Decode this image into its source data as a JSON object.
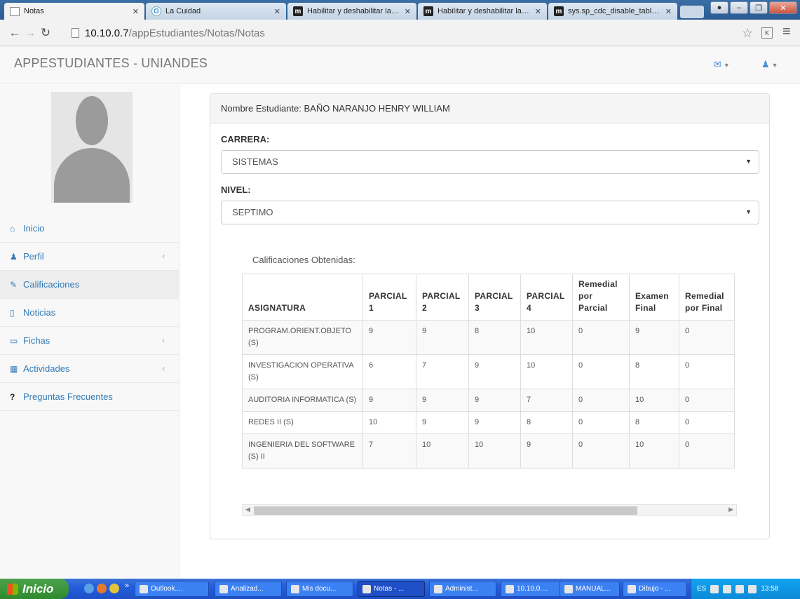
{
  "browser": {
    "tabs": [
      {
        "title": "Notas",
        "icon": "page-icon",
        "active": true
      },
      {
        "title": "La Cuidad",
        "icon": "google-icon",
        "active": false
      },
      {
        "title": "Habilitar y deshabilitar la cap",
        "icon": "m-icon",
        "active": false
      },
      {
        "title": "Habilitar y deshabilitar la cap",
        "icon": "m-icon",
        "active": false
      },
      {
        "title": "sys.sp_cdc_disable_table (Tr",
        "icon": "m-icon",
        "active": false
      }
    ],
    "url_host": "10.10.0.7",
    "url_path": "/appEstudiantes/Notas/Notas"
  },
  "app": {
    "brand": "APPESTUDIANTES - UNIANDES",
    "accent_color": "#337ab7"
  },
  "sidebar": {
    "items": [
      {
        "label": "Inicio",
        "icon": "home-icon",
        "has_arrow": false
      },
      {
        "label": "Perfil",
        "icon": "user-icon",
        "has_arrow": true
      },
      {
        "label": "Calificaciones",
        "icon": "edit-icon",
        "has_arrow": false,
        "active": true
      },
      {
        "label": "Noticias",
        "icon": "file-icon",
        "has_arrow": false
      },
      {
        "label": "Fichas",
        "icon": "folder-icon",
        "has_arrow": true
      },
      {
        "label": "Actividades",
        "icon": "calendar-icon",
        "has_arrow": true
      },
      {
        "label": "Preguntas Frecuentes",
        "icon": "question-icon",
        "has_arrow": false
      }
    ]
  },
  "main": {
    "student_heading": "Nombre Estudiante: BAÑO NARANJO HENRY WILLIAM",
    "carrera_label": "CARRERA:",
    "carrera_value": "SISTEMAS",
    "nivel_label": "NIVEL:",
    "nivel_value": "SEPTIMO",
    "table_caption": "Calificaciones Obtenidas:",
    "table": {
      "headers": [
        "ASIGNATURA",
        "PARCIAL 1",
        "PARCIAL 2",
        "PARCIAL 3",
        "PARCIAL 4",
        "Remedial por Parcial",
        "Examen Final",
        "Remedial por Final"
      ],
      "rows": [
        [
          "PROGRAM.ORIENT.OBJETO (S)",
          "9",
          "9",
          "8",
          "10",
          "0",
          "9",
          "0"
        ],
        [
          "INVESTIGACION OPERATIVA (S)",
          "6",
          "7",
          "9",
          "10",
          "0",
          "8",
          "0"
        ],
        [
          "AUDITORIA INFORMATICA (S)",
          "9",
          "9",
          "9",
          "7",
          "0",
          "10",
          "0"
        ],
        [
          "REDES II (S)",
          "10",
          "9",
          "9",
          "8",
          "0",
          "8",
          "0"
        ],
        [
          "INGENIERIA DEL SOFTWARE (S) II",
          "7",
          "10",
          "10",
          "9",
          "0",
          "10",
          "0"
        ]
      ]
    }
  },
  "taskbar": {
    "start_label": "Inicio",
    "tasks": [
      "Outlook....",
      "Analizad...",
      "Mis docu...",
      "Notas - ...",
      "Administ...",
      "10.10.0....",
      "MANUAL...",
      "Dibujo - ..."
    ],
    "lang": "ES",
    "clock": "13:58"
  }
}
